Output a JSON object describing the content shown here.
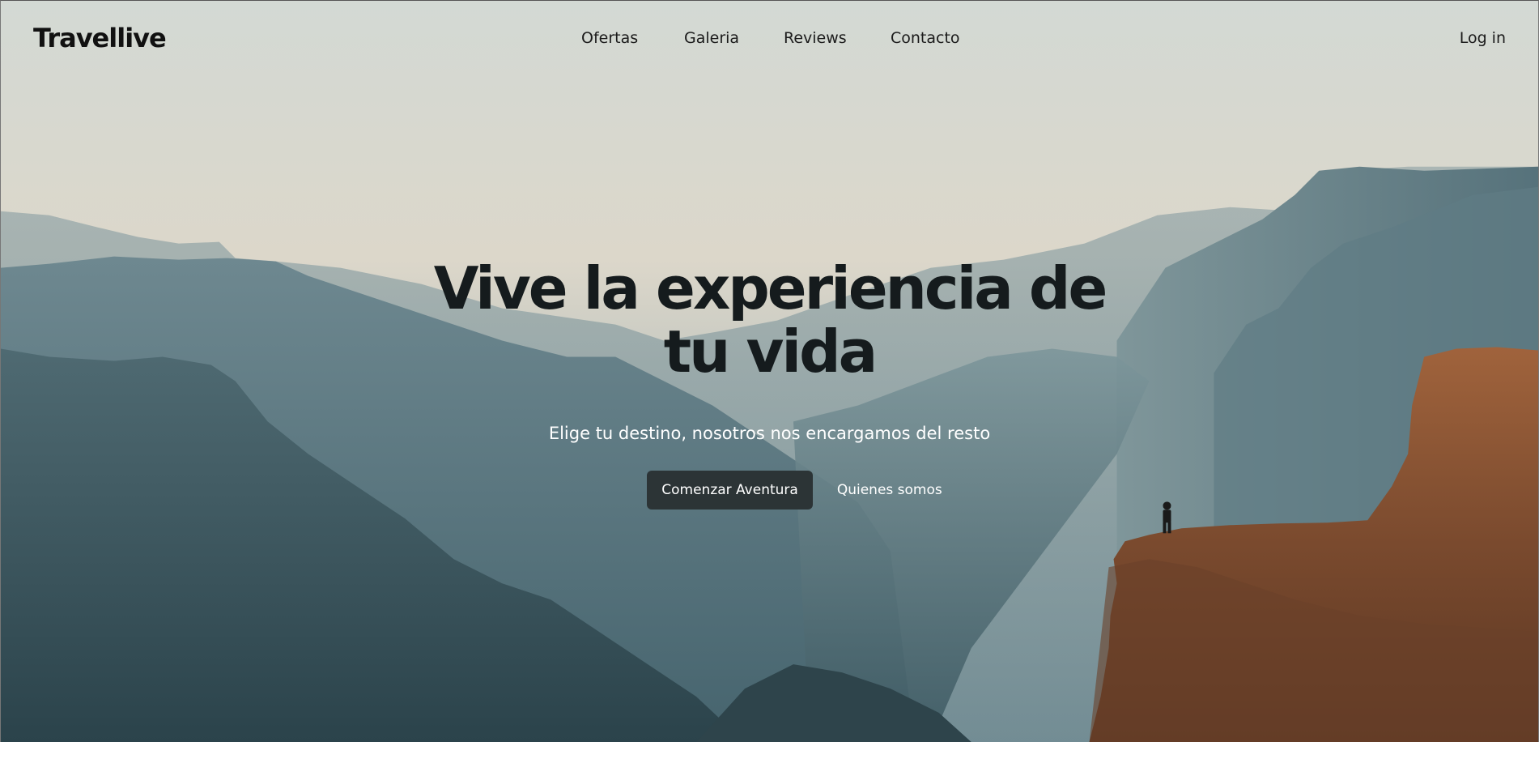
{
  "brand": {
    "name": "Travellive"
  },
  "nav": {
    "links": [
      "Ofertas",
      "Galeria",
      "Reviews",
      "Contacto"
    ],
    "login": "Log in"
  },
  "hero": {
    "title": "Vive la experiencia de tu vida",
    "subtitle": "Elige tu destino, nosotros nos encargamos del resto",
    "primary_button": "Comenzar Aventura",
    "secondary_button": "Quienes somos",
    "background": "mountain-canyon-landscape-photo"
  },
  "colors": {
    "sky_top": "#d3d9d4",
    "sky_mid": "#dcd7ca",
    "mountain_far": "#8a9ea3",
    "mountain_mid": "#5e7c86",
    "mountain_dark": "#2f4a52",
    "cliff": "#7a4a2e",
    "button_bg": "#2c3436"
  }
}
